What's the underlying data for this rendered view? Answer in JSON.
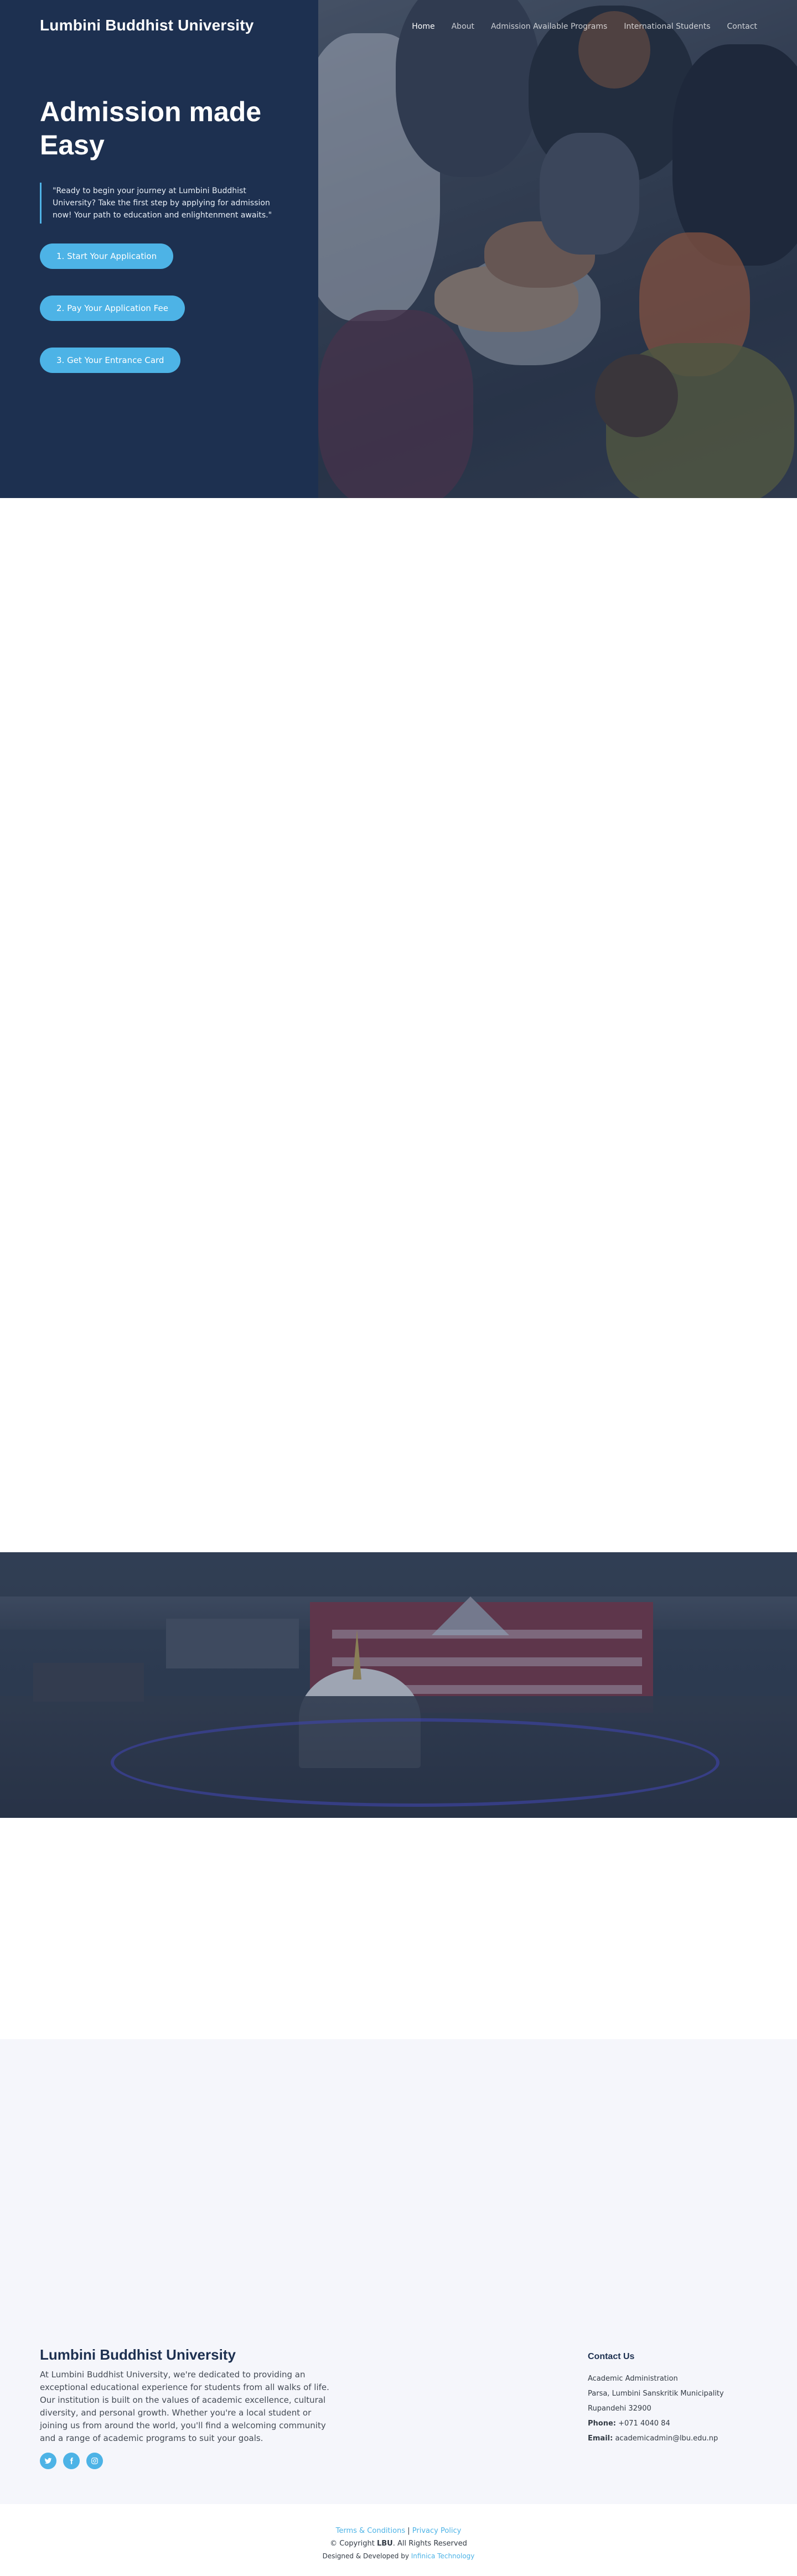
{
  "header": {
    "logo": "Lumbini Buddhist University",
    "nav": [
      "Home",
      "About",
      "Admission Available Programs",
      "International Students",
      "Contact"
    ]
  },
  "hero": {
    "title": "Admission made Easy",
    "quote": "\"Ready to begin your journey at Lumbini Buddhist University? Take the first step by applying for admission now! Your path to education and enlightenment awaits.\"",
    "buttons": [
      "1. Start Your Application",
      "2. Pay Your Application Fee",
      "3. Get Your Entrance Card"
    ]
  },
  "footer": {
    "title": "Lumbini Buddhist University",
    "description": "At Lumbini Buddhist University, we're dedicated to providing an exceptional educational experience for students from all walks of life. Our institution is built on the values of academic excellence, cultural diversity, and personal growth. Whether you're a local student or joining us from around the world, you'll find a welcoming community and a range of academic programs to suit your goals.",
    "socials": [
      "twitter-icon",
      "facebook-icon",
      "instagram-icon"
    ],
    "contact": {
      "heading": "Contact Us",
      "line1": "Academic Administration",
      "line2": "Parsa, Lumbini Sanskritik Municipality",
      "line3": "Rupandehi 32900",
      "phone_label": "Phone:",
      "phone": "+071 4040 84",
      "email_label": "Email:",
      "email": "academicadmin@lbu.edu.np"
    }
  },
  "bottom": {
    "terms": "Terms & Conditions",
    "separator": "|",
    "privacy": "Privacy Policy",
    "copyright_pre": "© Copyright",
    "copyright_brand": "LBU",
    "copyright_post": ". All Rights Reserved",
    "designed_by": "Designed & Developed by",
    "developer": "Infinica Technology"
  },
  "colors": {
    "navy": "#1d3050",
    "accent": "#4db3e6",
    "light_bg": "#f5f6fb"
  }
}
